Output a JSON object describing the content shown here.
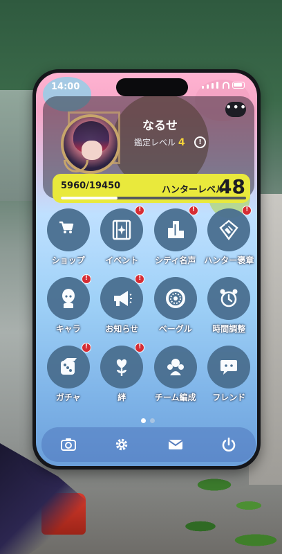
{
  "status_bar": {
    "time": "14:00"
  },
  "profile": {
    "name": "なるせ",
    "appraisal_label": "鑑定レベル",
    "appraisal_level": "4",
    "info_symbol": "!",
    "more_symbol": "•••",
    "exp_text": "5960/19450",
    "exp_fraction": 0.306,
    "hunter_label": "ハンターレベル",
    "hunter_level": "48"
  },
  "apps": [
    {
      "label": "ショップ",
      "icon": "cart-icon",
      "badge": false
    },
    {
      "label": "イベント",
      "icon": "film-sparkle-icon",
      "badge": true
    },
    {
      "label": "シティ名声",
      "icon": "buildings-icon",
      "badge": true
    },
    {
      "label": "ハンター褒章",
      "icon": "medal-icon",
      "badge": true
    },
    {
      "label": "キャラ",
      "icon": "character-icon",
      "badge": true
    },
    {
      "label": "お知らせ",
      "icon": "megaphone-icon",
      "badge": true
    },
    {
      "label": "ベーグル",
      "icon": "bagel-icon",
      "badge": false
    },
    {
      "label": "時間調整",
      "icon": "alarm-clock-icon",
      "badge": false
    },
    {
      "label": "ガチャ",
      "icon": "dice-icon",
      "badge": true
    },
    {
      "label": "絆",
      "icon": "heart-flower-icon",
      "badge": true
    },
    {
      "label": "チーム編成",
      "icon": "team-icon",
      "badge": false
    },
    {
      "label": "フレンド",
      "icon": "chat-bubble-icon",
      "badge": false
    }
  ],
  "badge_symbol": "!",
  "pager": {
    "pages": 2,
    "current": 1
  },
  "dock": [
    {
      "icon": "camera-icon"
    },
    {
      "icon": "gear-icon"
    },
    {
      "icon": "mail-icon"
    },
    {
      "icon": "power-icon"
    }
  ],
  "colors": {
    "accent_yellow": "#e9e93c",
    "badge_red": "#d9242a",
    "level_yellow": "#f4d23a"
  }
}
